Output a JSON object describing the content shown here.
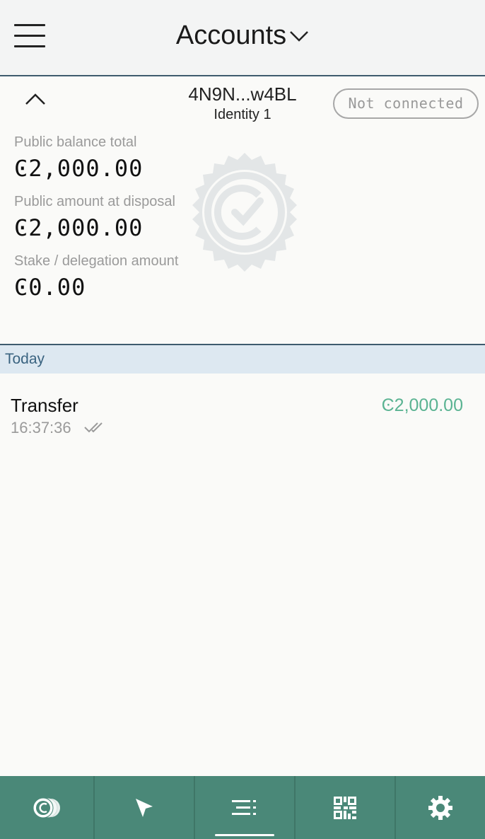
{
  "header": {
    "title": "Accounts"
  },
  "account": {
    "address": "4N9N...w4BL",
    "identity": "Identity 1",
    "status": "Not connected",
    "balances": [
      {
        "label": "Public balance total",
        "value": "Ͼ2,000.00"
      },
      {
        "label": "Public amount at disposal",
        "value": "Ͼ2,000.00"
      },
      {
        "label": "Stake / delegation amount",
        "value": "Ͼ0.00"
      }
    ]
  },
  "transactions": {
    "section_label": "Today",
    "items": [
      {
        "type": "Transfer",
        "time": "16:37:36",
        "amount": "Ͼ2,000.00"
      }
    ]
  },
  "nav": {
    "items": [
      {
        "icon": "accounts-icon"
      },
      {
        "icon": "send-icon"
      },
      {
        "icon": "transactions-list-icon",
        "active": true
      },
      {
        "icon": "qr-code-icon"
      },
      {
        "icon": "settings-gear-icon"
      }
    ]
  },
  "colors": {
    "header_bg": "#f3f4f4",
    "accent_line": "#3e5b6e",
    "section_bg": "#dde8f1",
    "positive_amount": "#5ab392",
    "nav_bg": "#4a8878"
  }
}
